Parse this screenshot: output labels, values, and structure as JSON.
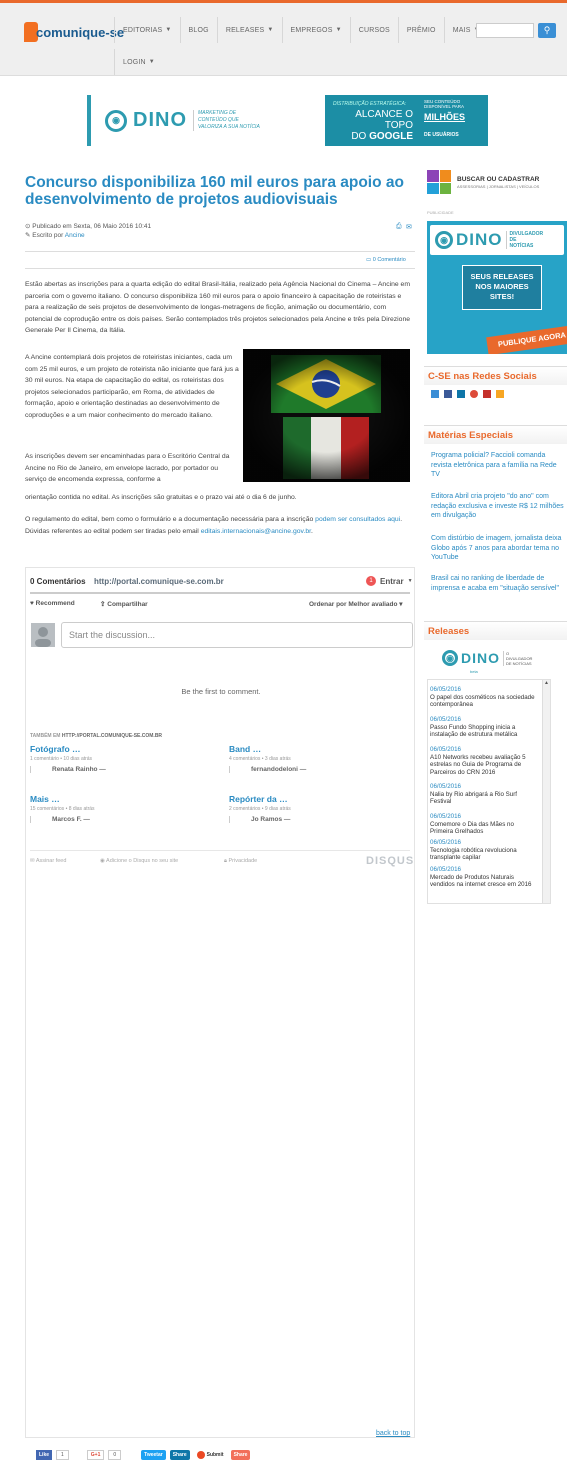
{
  "header": {
    "logo_text": "comunique-se",
    "nav": [
      "EDITORIAS",
      "BLOG",
      "RELEASES",
      "EMPREGOS",
      "CURSOS",
      "PRÊMIO",
      "MAIS",
      "LOGIN"
    ],
    "search_icon": "magnifier-icon"
  },
  "banner": {
    "brand": "DINO",
    "tagline": "MARKETING DE CONTEÚDO QUE VALORIZA A SUA NOTÍCIA",
    "small": "DISTRIBUIÇÃO ESTRATÉGICA:",
    "line1": "ALCANCE O TOPO",
    "line2": "DO",
    "google": "GOOGLE",
    "right_small": "SEU CONTEÚDO DISPONÍVEL PARA",
    "millions": "MILHÕES",
    "users": "DE USUÁRIOS"
  },
  "article": {
    "title": "Concurso disponibiliza 160 mil euros para apoio ao desenvolvimento de projetos audiovisuais",
    "published": "Publicado em Sexta, 06 Maio 2016 10:41",
    "author_prefix": "Escrito por",
    "author": "Ancine",
    "comments_link": "0 Comentário",
    "p1": "Estão abertas as inscrições para a quarta edição do edital Brasil-Itália, realizado pela Agência Nacional do Cinema – Ancine em parceria com o governo italiano. O concurso disponibiliza 160 mil euros para o apoio financeiro à capacitação de roteiristas e para a realização de seis projetos de desenvolvimento de longas-metragens de ficção, animação ou documentário, com potencial de coprodução entre os dois países. Serão contemplados três projetos selecionados pela Ancine e três pela Direzione Generale Per Il Cinema, da Itália.",
    "p2": "A Ancine contemplará dois projetos de roteiristas iniciantes, cada um com 25 mil euros, e um projeto de roteirista não iniciante que fará jus a 30 mil euros. Na etapa de capacitação do edital, os roteiristas dos projetos selecionados participarão, em Roma, de atividades de formação, apoio e orientação destinadas ao desenvolvimento de coproduções e a um maior conhecimento do mercado italiano.",
    "p3": "As inscrições devem ser encaminhadas para o Escritório Central da Ancine no Rio de Janeiro, em envelope lacrado, por portador ou serviço de encomenda expressa, conforme a",
    "p3b": "orientação contida no edital. As inscrições são gratuitas e o prazo vai até o dia 6 de junho.",
    "p4a": "O regulamento do edital, bem como o formulário e a documentação necessária para a inscrição",
    "p4link": "podem ser consultados aqui",
    "p4b": ". Dúvidas referentes ao edital podem ser tiradas pelo email",
    "p4email": "editais.internacionais@ancine.gov.br",
    "p4c": "."
  },
  "disqus": {
    "count": "0 Comentários",
    "site": "http://portal.comunique-se.com.br",
    "login": "Entrar",
    "notif": "1",
    "recommend": "Recommend",
    "share": "Compartilhar",
    "sort": "Ordenar por Melhor avaliado",
    "placeholder": "Start the discussion...",
    "empty": "Be the first to comment.",
    "also_prefix": "TAMBÉM EM",
    "also_site": "HTTP://PORTAL.COMUNIQUE-SE.COM.BR",
    "threads": [
      {
        "title": "Fotógrafo …",
        "meta": "1 comentário • 10 dias atrás",
        "user": "Renata Rainho —"
      },
      {
        "title": "Band …",
        "meta": "4 comentários • 3 dias atrás",
        "user": "fernandodeloni —"
      },
      {
        "title": "Mais …",
        "meta": "15 comentários • 8 dias atrás",
        "user": "Marcos F. —"
      },
      {
        "title": "Repórter da …",
        "meta": "2 comentários • 9 dias atrás",
        "user": "Jo Ramos —"
      }
    ],
    "subscribe": "Assinar feed",
    "add": "Adicione o Disqus no seu site",
    "privacy": "Privacidade",
    "brand": "DISQUS"
  },
  "sidebar": {
    "search_title": "BUSCAR OU CADASTRAR",
    "search_sub": "ASSESSORIAS | JORNALISTAS | VEÍCULOS",
    "ad_label": "PUBLICIDADE",
    "ad_brand": "DINO",
    "ad_brand_side": "DIVULGADOR DE NOTÍCIAS",
    "ad_line1": "SEUS RELEASES",
    "ad_line2": "NOS MAIORES",
    "ad_line3": "SITES!",
    "ad_cta": "PUBLIQUE AGORA",
    "social_title": "C-SE nas Redes Sociais",
    "special_title": "Matérias Especiais",
    "special": [
      "Programa policial? Faccioli comanda revista eletrônica para a família na Rede TV",
      "Editora Abril cria projeto \"do ano\" com redação exclusiva e investe R$ 12 milhões em divulgação",
      "Com distúrbio de imagem, jornalista deixa Globo após 7 anos para abordar tema no YouTube",
      "Brasil cai no ranking de liberdade de imprensa e acaba em \"situação sensível\""
    ],
    "releases_title": "Releases",
    "releases_brand": "DINO",
    "releases_brand_side": "O DIVULGADOR DE NOTÍCIAS",
    "releases_beta": "beta",
    "releases": [
      {
        "date": "06/05/2016",
        "text": "O papel dos cosméticos na sociedade contemporânea"
      },
      {
        "date": "06/05/2016",
        "text": "Passo Fundo Shopping inicia a instalação de estrutura metálica"
      },
      {
        "date": "06/05/2016",
        "text": "A10 Networks recebeu avaliação 5 estrelas no Guia de Programa de Parceiros do CRN 2016"
      },
      {
        "date": "06/05/2016",
        "text": "Nalia by Rio abrigará a Rio Surf Festival"
      },
      {
        "date": "06/05/2016",
        "text": "Comemore o Dia das Mães no Primeira Grelhados"
      },
      {
        "date": "06/05/2016",
        "text": "Tecnologia robótica revoluciona transplante capilar"
      },
      {
        "date": "06/05/2016",
        "text": "Mercado de Produtos Naturais vendidos na internet cresce em 2016"
      }
    ]
  },
  "footer": {
    "back_to_top": "back to top",
    "like": "Like",
    "like_count": "1",
    "gplus": "G+1",
    "gplus_count": "0",
    "tweet": "Tweetar",
    "linkedin": "Share",
    "submit": "Submit",
    "share": "Share"
  },
  "colors": {
    "accent": "#e9692c",
    "link": "#2a8bc2",
    "dino": "#2d9bb0"
  }
}
